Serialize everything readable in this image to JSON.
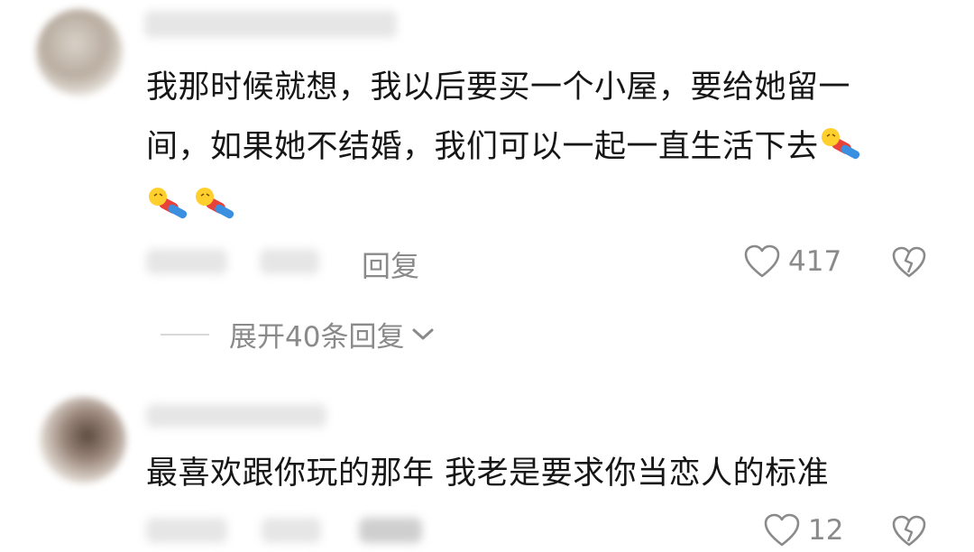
{
  "comments": [
    {
      "text_line1": "我那时候就想，我以后要买一个小屋，要给她留一",
      "text_line2": "间，如果她不结婚，我们可以一起一直生活下去",
      "emoji_names": [
        "tumbling-doll-emoji",
        "tumbling-doll-emoji",
        "tumbling-doll-emoji"
      ],
      "reply_label": "回复",
      "like_count": "417",
      "expand_label": "展开40条回复"
    },
    {
      "text_line1": "最喜欢跟你玩的那年 我老是要求你当恋人的标准",
      "like_count": "12"
    }
  ],
  "colors": {
    "text": "#161616",
    "muted": "#8a8a8a",
    "divider": "#d8d8d8",
    "emoji_red": "#e8423a",
    "emoji_blue": "#3a8fe0",
    "emoji_yellow": "#ffcf2e"
  },
  "icons": [
    "heart-outline-icon",
    "broken-heart-icon",
    "chevron-down-icon"
  ]
}
